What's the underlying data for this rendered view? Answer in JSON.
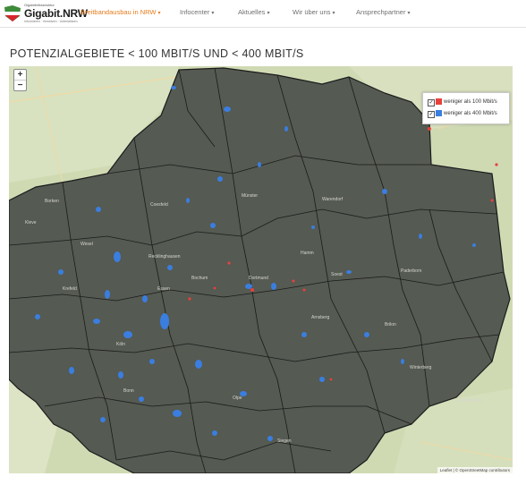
{
  "header": {
    "logo_top_text": "Gigabitinfrastruktur",
    "logo_name": "Gigabit.NRW",
    "logo_subtext": "Informieren · Vernetzen · Unterstützen",
    "colors": {
      "accent": "#e57c1e",
      "nav_text": "#707070",
      "logo_green": "#3e8b3a",
      "logo_red": "#d7262d"
    }
  },
  "nav": {
    "items": [
      {
        "label": "Breitbandausbau in NRW",
        "active": true
      },
      {
        "label": "Infocenter",
        "active": false
      },
      {
        "label": "Aktuelles",
        "active": false
      },
      {
        "label": "Wir über uns",
        "active": false
      },
      {
        "label": "Ansprechpartner",
        "active": false
      }
    ]
  },
  "page": {
    "title": "POTENZIALGEBIETE < 100 MBIT/S UND < 400 MBIT/S"
  },
  "map": {
    "zoom_in": "+",
    "zoom_out": "−",
    "legend": [
      {
        "label": "weniger als 100 Mbit/s",
        "color": "#e8413c",
        "checked": true
      },
      {
        "label": "weniger als 400 Mbit/s",
        "color": "#3a7ee0",
        "checked": true
      }
    ],
    "attribution": "Leaflet | © OpenStreetMap contributors",
    "place_labels": [
      "Borken",
      "Coesfeld",
      "Münster",
      "Warendorf",
      "Dortmund",
      "Bochum",
      "Recklinghausen",
      "Hamm",
      "Soest",
      "Paderborn",
      "Wesel",
      "Kleve",
      "Krefeld",
      "Essen",
      "Arnsberg",
      "Siegen",
      "Köln",
      "Bonn",
      "Brilon",
      "Frankenberg",
      "Winterberg",
      "Olpe"
    ],
    "colors": {
      "overlay": "#555a52",
      "boundary": "#1b1b1b",
      "coverage_400": "#3a7ee0",
      "coverage_100": "#e8413c",
      "basemap": "#c9d6ad"
    }
  }
}
